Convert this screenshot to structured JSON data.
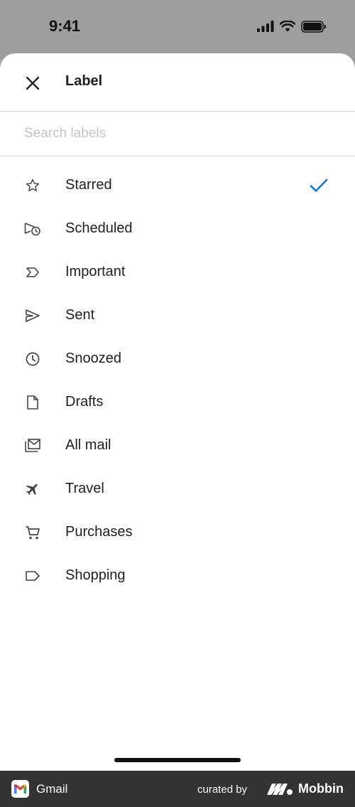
{
  "status_bar": {
    "time": "9:41"
  },
  "header": {
    "title": "Label",
    "close_icon": "close-icon"
  },
  "search": {
    "placeholder": "Search labels",
    "value": ""
  },
  "labels": [
    {
      "label": "Starred",
      "icon": "star-icon",
      "selected": true
    },
    {
      "label": "Scheduled",
      "icon": "scheduled-send-icon",
      "selected": false
    },
    {
      "label": "Important",
      "icon": "important-icon",
      "selected": false
    },
    {
      "label": "Sent",
      "icon": "send-icon",
      "selected": false
    },
    {
      "label": "Snoozed",
      "icon": "clock-icon",
      "selected": false
    },
    {
      "label": "Drafts",
      "icon": "draft-icon",
      "selected": false
    },
    {
      "label": "All mail",
      "icon": "all-mail-icon",
      "selected": false
    },
    {
      "label": "Travel",
      "icon": "airplane-icon",
      "selected": false
    },
    {
      "label": "Purchases",
      "icon": "cart-icon",
      "selected": false
    },
    {
      "label": "Shopping",
      "icon": "label-tag-icon",
      "selected": false
    }
  ],
  "colors": {
    "accent": "#1a73e8",
    "footer_bg": "#333333",
    "backdrop": "#9e9e9e"
  },
  "footer": {
    "app_name": "Gmail",
    "curated_by": "curated by",
    "brand": "Mobbin"
  }
}
